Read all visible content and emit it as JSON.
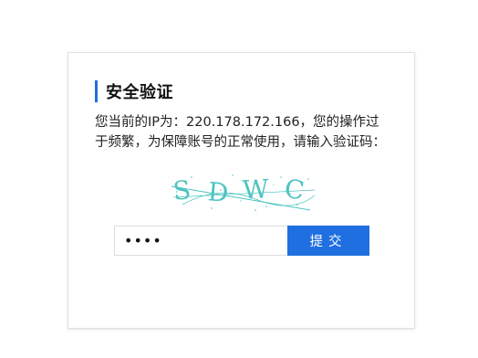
{
  "dialog": {
    "title": "安全验证",
    "message": "您当前的IP为：220.178.172.166，您的操作过于频繁，为保障账号的正常使用，请输入验证码：",
    "captcha": {
      "characters": [
        "S",
        "D",
        "W",
        "C"
      ],
      "color": "#4cc4c0"
    },
    "input": {
      "value": "••••",
      "placeholder": ""
    },
    "submit_label": "提交"
  },
  "colors": {
    "accent": "#1f6fe0",
    "border": "#e2e2e2"
  }
}
